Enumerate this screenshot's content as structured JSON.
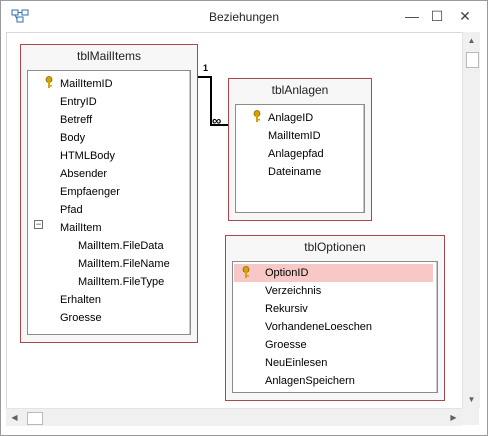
{
  "window": {
    "title": "Beziehungen"
  },
  "controls": {
    "minimize": "—",
    "maximize": "☐",
    "close": "✕"
  },
  "tables": {
    "mailitems": {
      "name": "tblMailItems",
      "fields": [
        "MailItemID",
        "EntryID",
        "Betreff",
        "Body",
        "HTMLBody",
        "Absender",
        "Empfaenger",
        "Pfad",
        "MailItem",
        "MailItem.FileData",
        "MailItem.FileName",
        "MailItem.FileType",
        "Erhalten",
        "Groesse"
      ],
      "primary_key": "MailItemID"
    },
    "anlagen": {
      "name": "tblAnlagen",
      "fields": [
        "AnlageID",
        "MailItemID",
        "Anlagepfad",
        "Dateiname"
      ],
      "primary_key": "AnlageID"
    },
    "optionen": {
      "name": "tblOptionen",
      "fields": [
        "OptionID",
        "Verzeichnis",
        "Rekursiv",
        "VorhandeneLoeschen",
        "Groesse",
        "NeuEinlesen",
        "AnlagenSpeichern"
      ],
      "primary_key": "OptionID",
      "selected": "OptionID"
    }
  },
  "relationship": {
    "one_label": "1",
    "many_label": "∞"
  },
  "expand_symbol": "−",
  "colors": {
    "table_border": "#a8484e",
    "selected_field": "#f7c8c6",
    "key_icon": "#d8a200"
  }
}
